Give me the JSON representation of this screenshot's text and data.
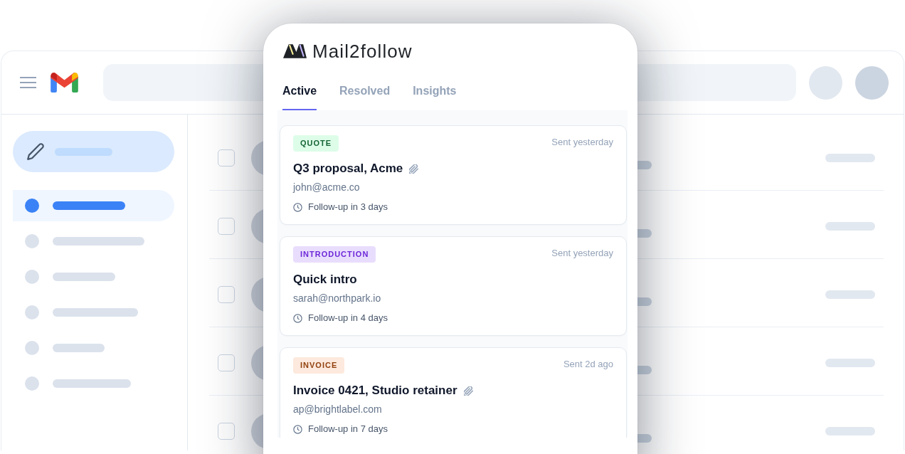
{
  "mail_window": {
    "sidebar": {
      "nav_items": [
        {
          "selected": true
        },
        {
          "selected": false
        },
        {
          "selected": false
        },
        {
          "selected": false
        },
        {
          "selected": false
        },
        {
          "selected": false
        }
      ]
    },
    "email_rows": [
      {
        "checked": false
      },
      {
        "checked": false
      },
      {
        "checked": false
      },
      {
        "checked": false
      },
      {
        "checked": false
      }
    ]
  },
  "panel": {
    "brand": "Mail2follow",
    "tabs": [
      {
        "label": "Active",
        "selected": true
      },
      {
        "label": "Resolved",
        "selected": false
      },
      {
        "label": "Insights",
        "selected": false
      }
    ],
    "cards": [
      {
        "tag": {
          "label": "QUOTE",
          "color": "#166534"
        },
        "sent": "Sent yesterday",
        "subject": "Q3 proposal, Acme",
        "has_attachment": true,
        "email": "john@acme.co",
        "follow_up": "Follow-up in 3 days"
      },
      {
        "tag": {
          "label": "INTRODUCTION",
          "color": "#6d28d9"
        },
        "sent": "Sent yesterday",
        "subject": "Quick intro",
        "has_attachment": false,
        "email": "sarah@northpark.io",
        "follow_up": "Follow-up in 4 days"
      },
      {
        "tag": {
          "label": "INVOICE",
          "color": "#92400e"
        },
        "sent": "Sent 2d ago",
        "subject": "Invoice 0421, Studio retainer",
        "has_attachment": true,
        "email": "ap@brightlabel.com",
        "follow_up": "Follow-up in 7 days"
      }
    ]
  }
}
